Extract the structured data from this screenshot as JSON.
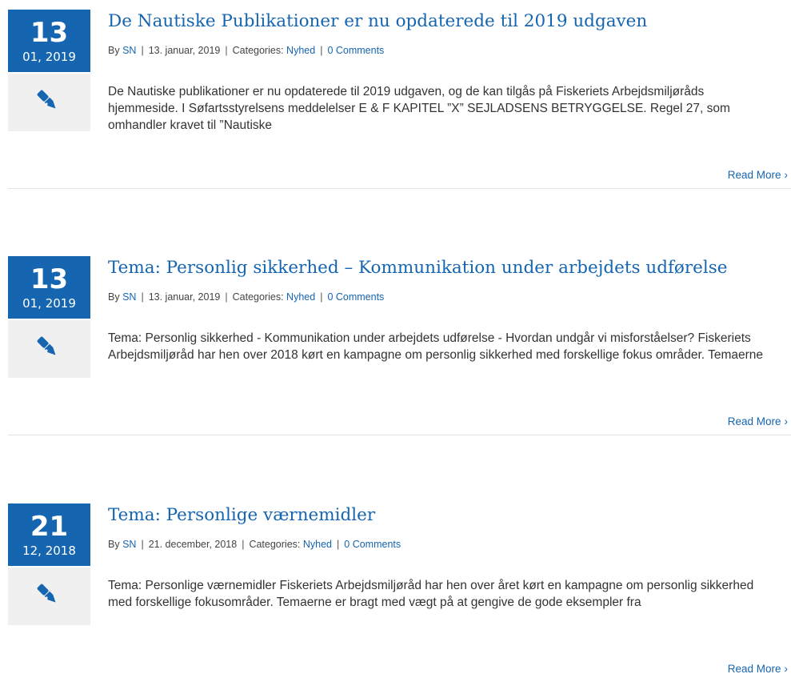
{
  "posts": [
    {
      "day": "13",
      "month_year": "01, 2019",
      "title": "De Nautiske Publikationer er nu opdaterede til 2019 udgaven",
      "by_label": "By",
      "author": "SN",
      "date": "13. januar, 2019",
      "categories_label": "Categories:",
      "category": "Nyhed",
      "comments": "0 Comments",
      "excerpt": "De Nautiske publikationer er nu opdaterede til 2019 udgaven, og de kan tilgås på Fiskeriets Arbejdsmiljøråds hjemmeside. I Søfartsstyrelsens meddelelser E & F KAPITEL ”X” SEJLADSENS BETRYGGELSE. Regel 27, som omhandler kravet til ”Nautiske",
      "read_more": "Read More"
    },
    {
      "day": "13",
      "month_year": "01, 2019",
      "title": "Tema: Personlig sikkerhed – Kommunikation under arbejdets udførelse",
      "by_label": "By",
      "author": "SN",
      "date": "13. januar, 2019",
      "categories_label": "Categories:",
      "category": "Nyhed",
      "comments": "0 Comments",
      "excerpt": "Tema: Personlig sikkerhed - Kommunikation under arbejdets udførelse  - Hvordan undgår vi misforståelser? Fiskeriets Arbejdsmiljøråd har hen over 2018 kørt en kampagne om personlig sikkerhed med forskellige fokus områder. Temaerne",
      "read_more": "Read More"
    },
    {
      "day": "21",
      "month_year": "12, 2018",
      "title": "Tema: Personlige værnemidler",
      "by_label": "By",
      "author": "SN",
      "date": "21. december, 2018",
      "categories_label": "Categories:",
      "category": "Nyhed",
      "comments": "0 Comments",
      "excerpt": "Tema: Personlige værnemidler Fiskeriets Arbejdsmiljøråd har hen over året kørt en kampagne om personlig sikkerhed med forskellige fokusområder. Temaerne er bragt med vægt på at gengive de gode eksempler fra",
      "read_more": "Read More"
    }
  ],
  "icons": {
    "post_format": "pen-icon",
    "read_more": "chevron-right-icon"
  },
  "colors": {
    "accent": "#1565b0",
    "format_box": "#f0f0f0",
    "text": "#333333",
    "divider": "#e4e4e4"
  }
}
